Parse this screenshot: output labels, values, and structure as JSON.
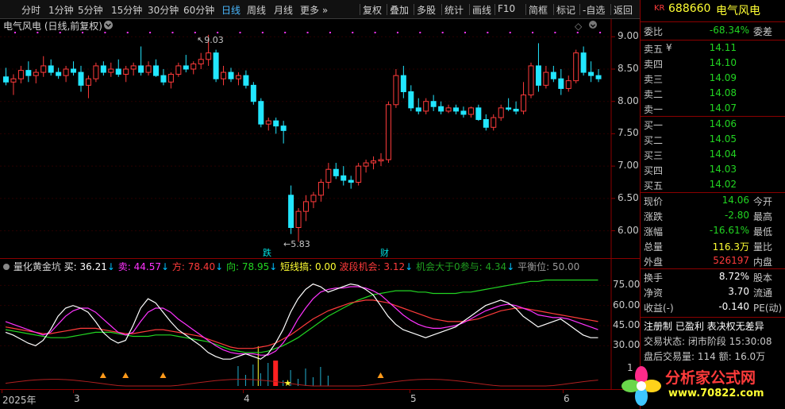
{
  "toolbar": {
    "periods": [
      "分时",
      "1分钟",
      "5分钟",
      "15分钟",
      "30分钟",
      "60分钟",
      "日线",
      "周线",
      "月线",
      "更多 »"
    ],
    "active_period": "日线",
    "actions": [
      "复权",
      "叠加",
      "多股",
      "统计",
      "画线",
      "F10",
      "简框",
      "标记",
      "-自选",
      "返回"
    ]
  },
  "main": {
    "title": "电气风电 (日线,前复权)",
    "high_label": "9.03",
    "low_label": "5.83",
    "event_die": "跌",
    "event_cai": "财",
    "price_axis": [
      "9.00",
      "8.50",
      "8.00",
      "7.50",
      "7.00",
      "6.50",
      "6.00"
    ]
  },
  "indicator": {
    "name": "量化黄金坑",
    "buy": "买: 36.21",
    "sell": "卖: 44.57",
    "fang": "方: 78.40",
    "xiang": "向: 78.95",
    "short": "短线搞: 0.00",
    "band": "波段机会: 3.12",
    "opportunity": "机会大于0参与: 4.34",
    "balance": "平衡位: 50.00",
    "axis": [
      "75.00",
      "60.00",
      "45.00",
      "30.00",
      "1"
    ]
  },
  "timeaxis": {
    "labels": [
      "2025年",
      "3",
      "4",
      "5",
      "6"
    ]
  },
  "quote": {
    "market": "KR",
    "code": "688660",
    "name": "电气风电",
    "weibi_label": "委比",
    "weibi": "-68.34%",
    "weicha_label": "委差",
    "asks": [
      {
        "label": "卖五",
        "flag": "¥",
        "price": "14.11"
      },
      {
        "label": "卖四",
        "flag": "",
        "price": "14.10"
      },
      {
        "label": "卖三",
        "flag": "",
        "price": "14.09"
      },
      {
        "label": "卖二",
        "flag": "",
        "price": "14.08"
      },
      {
        "label": "卖一",
        "flag": "",
        "price": "14.07"
      }
    ],
    "bids": [
      {
        "label": "买一",
        "price": "14.06"
      },
      {
        "label": "买二",
        "price": "14.05"
      },
      {
        "label": "买三",
        "price": "14.04"
      },
      {
        "label": "买四",
        "price": "14.03"
      },
      {
        "label": "买五",
        "price": "14.02"
      }
    ],
    "stats": [
      {
        "k": "现价",
        "v": "14.06",
        "k2": "今开",
        "c": "green"
      },
      {
        "k": "涨跌",
        "v": "-2.80",
        "k2": "最高",
        "c": "green"
      },
      {
        "k": "涨幅",
        "v": "-16.61%",
        "k2": "最低",
        "c": "green"
      },
      {
        "k": "总量",
        "v": "116.3万",
        "k2": "量比",
        "c": "yellow"
      },
      {
        "k": "外盘",
        "v": "526197",
        "k2": "内盘",
        "c": "red"
      }
    ],
    "stats2": [
      {
        "k": "换手",
        "v": "8.72%",
        "k2": "股本"
      },
      {
        "k": "净资",
        "v": "3.70",
        "k2": "流通"
      },
      {
        "k": "收益(-)",
        "v": "-0.140",
        "k2": "PE(动)"
      }
    ],
    "reg": "注册制 已盈利 表决权无差异",
    "trade_status": "交易状态: 闭市阶段 15:30:08",
    "after_hours": "盘后交易量: 114  额: 16.0万"
  },
  "logo": {
    "text": "分析家公式网",
    "url": "www.70822.com"
  },
  "colors": {
    "up": "#ff3b3b",
    "down": "#22e6ff",
    "buy_line": "#ffffff",
    "sell_line": "#ff33ff",
    "fang_line": "#ff3b3b",
    "xiang_line": "#22d422"
  },
  "chart_data": {
    "type": "candlestick",
    "price_range": [
      5.7,
      9.2
    ],
    "candles": [
      [
        8.38,
        8.52,
        8.25,
        8.3
      ],
      [
        8.3,
        8.42,
        8.1,
        8.35
      ],
      [
        8.35,
        8.55,
        8.28,
        8.48
      ],
      [
        8.48,
        8.62,
        8.3,
        8.4
      ],
      [
        8.4,
        8.5,
        8.28,
        8.45
      ],
      [
        8.45,
        8.7,
        8.38,
        8.55
      ],
      [
        8.55,
        8.65,
        8.4,
        8.45
      ],
      [
        8.45,
        8.52,
        8.35,
        8.4
      ],
      [
        8.4,
        8.55,
        8.3,
        8.5
      ],
      [
        8.5,
        8.62,
        8.4,
        8.45
      ],
      [
        8.45,
        8.55,
        8.15,
        8.25
      ],
      [
        8.25,
        8.4,
        8.05,
        8.35
      ],
      [
        8.35,
        8.6,
        8.3,
        8.55
      ],
      [
        8.55,
        8.62,
        8.4,
        8.45
      ],
      [
        8.45,
        8.6,
        8.38,
        8.5
      ],
      [
        8.5,
        8.65,
        8.38,
        8.42
      ],
      [
        8.42,
        8.55,
        8.3,
        8.5
      ],
      [
        8.5,
        8.6,
        8.4,
        8.55
      ],
      [
        8.55,
        8.85,
        8.4,
        8.45
      ],
      [
        8.45,
        8.62,
        8.4,
        8.55
      ],
      [
        8.55,
        8.65,
        8.38,
        8.4
      ],
      [
        8.4,
        8.5,
        8.25,
        8.3
      ],
      [
        8.3,
        8.45,
        8.2,
        8.42
      ],
      [
        8.42,
        8.6,
        8.38,
        8.55
      ],
      [
        8.55,
        8.72,
        8.45,
        8.5
      ],
      [
        8.5,
        8.62,
        8.42,
        8.58
      ],
      [
        8.58,
        8.75,
        8.5,
        8.65
      ],
      [
        8.65,
        9.03,
        8.55,
        8.75
      ],
      [
        8.75,
        8.8,
        8.3,
        8.35
      ],
      [
        8.35,
        8.55,
        8.25,
        8.45
      ],
      [
        8.45,
        8.52,
        8.3,
        8.35
      ],
      [
        8.35,
        8.45,
        8.25,
        8.4
      ],
      [
        8.4,
        8.48,
        8.2,
        8.25
      ],
      [
        8.25,
        8.3,
        7.95,
        8.0
      ],
      [
        8.0,
        8.05,
        7.6,
        7.65
      ],
      [
        7.65,
        7.75,
        7.55,
        7.7
      ],
      [
        7.7,
        7.75,
        7.5,
        7.62
      ],
      [
        7.62,
        7.7,
        7.35,
        7.55
      ],
      [
        6.55,
        6.7,
        5.95,
        6.05
      ],
      [
        6.05,
        6.35,
        5.83,
        6.3
      ],
      [
        6.3,
        6.55,
        6.15,
        6.45
      ],
      [
        6.45,
        6.6,
        6.35,
        6.55
      ],
      [
        6.55,
        6.8,
        6.45,
        6.75
      ],
      [
        6.75,
        7.05,
        6.65,
        6.95
      ],
      [
        6.95,
        7.05,
        6.8,
        6.85
      ],
      [
        6.85,
        7.0,
        6.7,
        6.78
      ],
      [
        6.78,
        6.85,
        6.65,
        6.75
      ],
      [
        6.75,
        7.05,
        6.7,
        7.0
      ],
      [
        7.0,
        7.1,
        6.9,
        7.05
      ],
      [
        7.05,
        7.15,
        6.95,
        7.08
      ],
      [
        7.08,
        7.2,
        7.0,
        7.1
      ],
      [
        7.1,
        8.0,
        7.05,
        7.95
      ],
      [
        7.95,
        8.5,
        7.9,
        8.4
      ],
      [
        8.4,
        8.55,
        8.05,
        8.15
      ],
      [
        8.15,
        8.25,
        7.85,
        7.9
      ],
      [
        7.9,
        8.05,
        7.8,
        7.85
      ],
      [
        7.85,
        8.05,
        7.8,
        8.0
      ],
      [
        8.0,
        8.1,
        7.85,
        7.92
      ],
      [
        7.92,
        8.0,
        7.8,
        7.85
      ],
      [
        7.85,
        7.95,
        7.82,
        7.9
      ],
      [
        7.9,
        7.95,
        7.8,
        7.85
      ],
      [
        7.85,
        7.92,
        7.75,
        7.8
      ],
      [
        7.8,
        7.92,
        7.75,
        7.9
      ],
      [
        7.9,
        7.95,
        7.7,
        7.72
      ],
      [
        7.72,
        7.8,
        7.55,
        7.6
      ],
      [
        7.6,
        7.8,
        7.55,
        7.75
      ],
      [
        7.75,
        7.95,
        7.7,
        7.9
      ],
      [
        7.9,
        8.05,
        7.85,
        7.88
      ],
      [
        7.88,
        8.0,
        7.8,
        7.85
      ],
      [
        7.85,
        8.3,
        7.8,
        8.1
      ],
      [
        8.1,
        8.6,
        8.05,
        8.55
      ],
      [
        8.55,
        8.9,
        8.15,
        8.25
      ],
      [
        8.25,
        8.55,
        8.2,
        8.45
      ],
      [
        8.45,
        8.55,
        8.3,
        8.35
      ],
      [
        8.35,
        8.5,
        8.1,
        8.2
      ],
      [
        8.2,
        8.4,
        8.15,
        8.32
      ],
      [
        8.32,
        8.8,
        8.28,
        8.75
      ],
      [
        8.75,
        8.85,
        8.4,
        8.45
      ],
      [
        8.45,
        8.62,
        8.3,
        8.4
      ],
      [
        8.4,
        8.5,
        8.3,
        8.35
      ]
    ],
    "indicator_range": [
      0,
      90
    ],
    "buy": [
      40,
      38,
      35,
      32,
      30,
      34,
      42,
      52,
      58,
      60,
      58,
      55,
      48,
      40,
      35,
      32,
      34,
      45,
      58,
      65,
      62,
      55,
      48,
      42,
      38,
      34,
      30,
      25,
      22,
      20,
      20,
      22,
      24,
      22,
      20,
      24,
      32,
      42,
      55,
      65,
      72,
      76,
      74,
      70,
      72,
      74,
      76,
      75,
      72,
      68,
      60,
      52,
      46,
      42,
      40,
      38,
      36,
      38,
      40,
      42,
      44,
      48,
      52,
      56,
      60,
      62,
      64,
      62,
      58,
      52,
      48,
      44,
      46,
      48,
      50,
      46,
      42,
      38,
      36,
      36
    ],
    "sell": [
      48,
      46,
      44,
      42,
      40,
      38,
      40,
      46,
      52,
      56,
      58,
      58,
      55,
      50,
      45,
      40,
      38,
      40,
      48,
      55,
      58,
      58,
      55,
      50,
      46,
      42,
      38,
      34,
      30,
      27,
      25,
      24,
      24,
      24,
      23,
      23,
      26,
      32,
      40,
      50,
      58,
      65,
      70,
      72,
      73,
      73,
      74,
      74,
      73,
      71,
      68,
      63,
      58,
      53,
      49,
      46,
      44,
      43,
      43,
      44,
      45,
      47,
      50,
      53,
      56,
      58,
      60,
      61,
      60,
      58,
      56,
      53,
      52,
      51,
      51,
      50,
      48,
      46,
      44,
      42
    ],
    "fang": [
      44,
      43,
      42,
      41,
      40,
      39,
      39,
      40,
      41,
      42,
      43,
      43,
      43,
      42,
      41,
      40,
      39,
      39,
      40,
      41,
      42,
      42,
      41,
      40,
      39,
      38,
      37,
      35,
      33,
      31,
      29,
      28,
      28,
      28,
      29,
      30,
      32,
      35,
      38,
      42,
      46,
      50,
      53,
      56,
      58,
      60,
      62,
      63,
      64,
      64,
      63,
      62,
      60,
      58,
      56,
      54,
      52,
      50,
      49,
      48,
      48,
      48,
      49,
      50,
      52,
      54,
      56,
      57,
      58,
      58,
      57,
      56,
      55,
      54,
      53,
      52,
      51,
      50,
      49,
      48
    ],
    "xiang": [
      42,
      41,
      40,
      39,
      38,
      37,
      36,
      36,
      36,
      37,
      38,
      39,
      40,
      40,
      40,
      39,
      38,
      37,
      37,
      37,
      38,
      38,
      38,
      37,
      36,
      35,
      34,
      33,
      31,
      29,
      27,
      26,
      25,
      25,
      25,
      26,
      28,
      30,
      33,
      36,
      40,
      44,
      48,
      52,
      55,
      58,
      61,
      64,
      66,
      68,
      69,
      70,
      71,
      71,
      71,
      70,
      70,
      69,
      69,
      69,
      69,
      70,
      70,
      71,
      72,
      73,
      74,
      75,
      76,
      77,
      78,
      78,
      79,
      79,
      79,
      79,
      79,
      79,
      79,
      79
    ]
  }
}
